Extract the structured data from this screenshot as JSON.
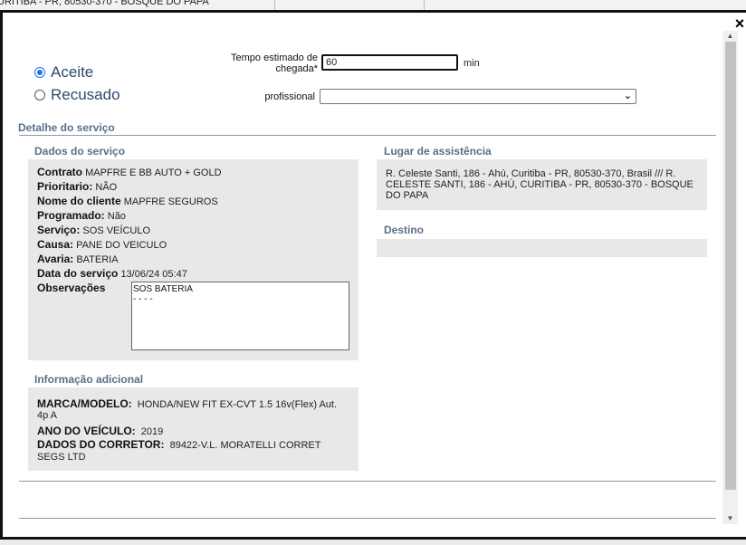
{
  "background": {
    "address_snippet": "URITIBA - PR, 80530-370 - BOSQUE DO PAPA"
  },
  "modal": {
    "close_label": "×",
    "status": {
      "options": [
        {
          "label": "Aceite",
          "checked": true
        },
        {
          "label": "Recusado",
          "checked": false
        }
      ]
    },
    "tempo": {
      "label": "Tempo estimado de chegada*",
      "value": "60",
      "unit": "min"
    },
    "profissional": {
      "label": "profissional",
      "value": ""
    },
    "detalhe_title": "Detalhe do serviço",
    "dados_servico": {
      "title": "Dados do serviço",
      "fields": [
        {
          "key": "Contrato",
          "value": "MAPFRE E BB AUTO + GOLD"
        },
        {
          "key": "Prioritario:",
          "value": "NÃO"
        },
        {
          "key": "Nome do cliente",
          "value": "MAPFRE SEGUROS"
        },
        {
          "key": "Programado:",
          "value": "Não"
        },
        {
          "key": "Serviço:",
          "value": "SOS VEÍCULO"
        },
        {
          "key": "Causa:",
          "value": "PANE DO VEICULO"
        },
        {
          "key": "Avaria:",
          "value": "BATERIA"
        },
        {
          "key": "Data do serviço",
          "value": "13/06/24 05:47"
        },
        {
          "key": "Observações",
          "value": ""
        }
      ],
      "observacoes_lines": [
        "SOS BATERIA",
        "- - - -"
      ]
    },
    "info_adicional": {
      "title": "Informação adicional",
      "fields": [
        {
          "key": "MARCA/MODELO:",
          "value": "HONDA/NEW FIT EX-CVT 1.5 16v(Flex) Aut. 4p A"
        },
        {
          "key": "ANO DO VEÍCULO:",
          "value": "2019"
        },
        {
          "key": "DADOS DO CORRETOR:",
          "value": "89422-V.L. MORATELLI CORRET SEGS LTD"
        }
      ]
    },
    "lugar": {
      "title": "Lugar de assistência",
      "text": "R. Celeste Santi, 186 - Ahú, Curitiba - PR, 80530-370, Brasil /// R. CELESTE SANTI, 186 - AHÚ, CURITIBA - PR, 80530-370 - BOSQUE DO PAPA"
    },
    "destino": {
      "title": "Destino",
      "text": ""
    }
  }
}
